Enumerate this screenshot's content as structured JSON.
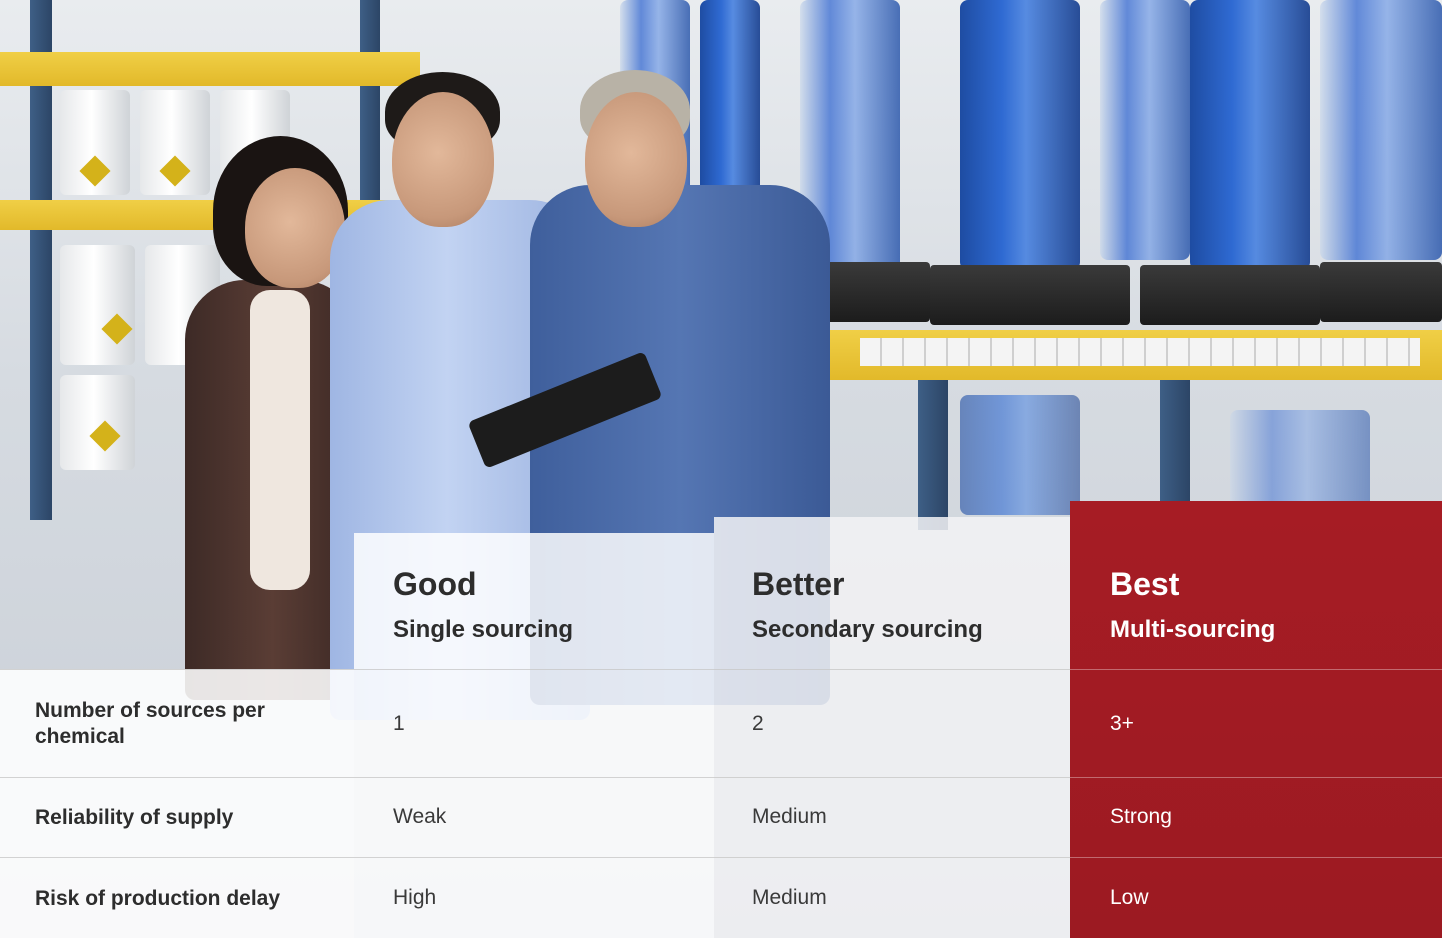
{
  "image": {
    "alt_subject": "warehouse-photo-three-people-clipboard"
  },
  "colors": {
    "best_column": "#a61c24",
    "text_dark": "#2d2d2d",
    "text_light": "#ffffff"
  },
  "columns": [
    {
      "title": "Good",
      "subtitle": "Single sourcing"
    },
    {
      "title": "Better",
      "subtitle": "Secondary sourcing"
    },
    {
      "title": "Best",
      "subtitle": "Multi-sourcing"
    }
  ],
  "rows": [
    {
      "label": "Number of sources per chemical",
      "values": [
        "1",
        "2",
        "3+"
      ]
    },
    {
      "label": "Reliability of supply",
      "values": [
        "Weak",
        "Medium",
        "Strong"
      ]
    },
    {
      "label": "Risk of production delay",
      "values": [
        "High",
        "Medium",
        "Low"
      ]
    }
  ]
}
